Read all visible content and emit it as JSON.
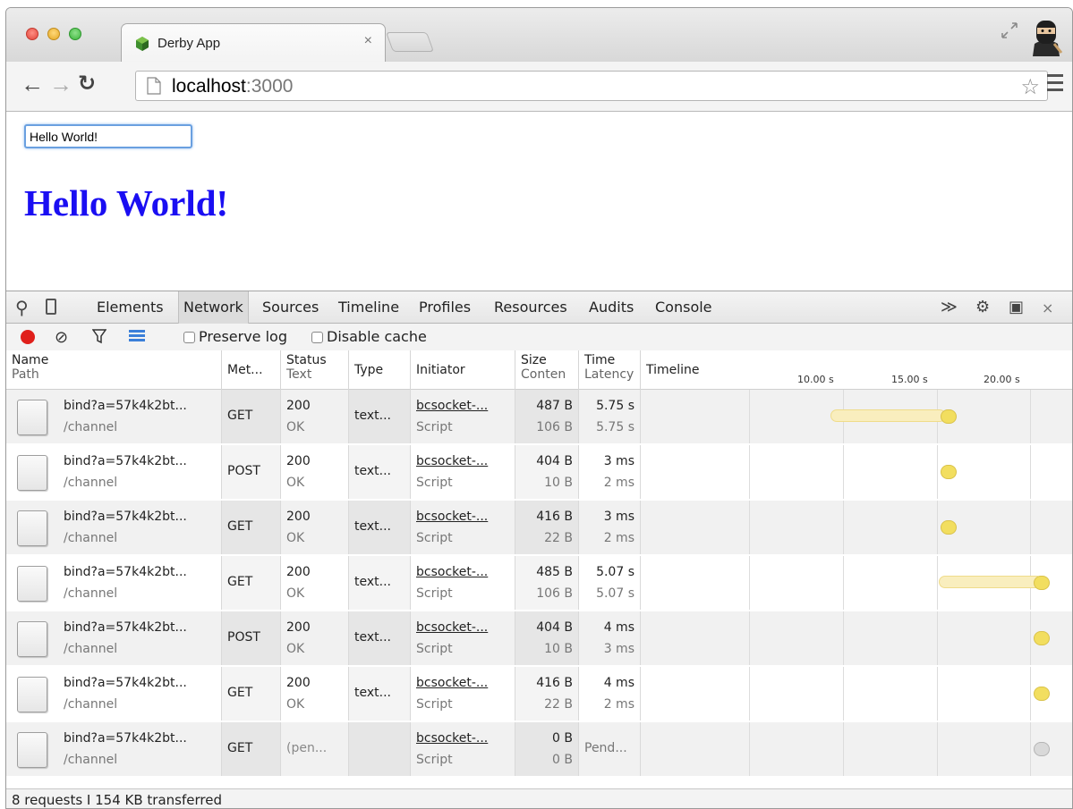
{
  "browser": {
    "tab_title": "Derby App",
    "tab_close": "×",
    "url_host": "localhost",
    "url_port": ":3000"
  },
  "page": {
    "input_value": "Hello World!",
    "heading": "Hello World!"
  },
  "devtools": {
    "tabs": [
      "Elements",
      "Network",
      "Sources",
      "Timeline",
      "Profiles",
      "Resources",
      "Audits",
      "Console"
    ],
    "active_tab": "Network",
    "close": "×",
    "toolbar": {
      "preserve_log": "Preserve log",
      "disable_cache": "Disable cache"
    },
    "columns": {
      "name": "Name",
      "path": "Path",
      "method": "Met...",
      "status": "Status",
      "status_text": "Text",
      "type": "Type",
      "initiator": "Initiator",
      "size": "Size",
      "content": "Conten",
      "time": "Time",
      "latency": "Latency",
      "timeline": "Timeline"
    },
    "ticks": [
      "10.00 s",
      "15.00 s",
      "20.00 s"
    ],
    "rows": [
      {
        "name": "bind?a=57k4k2bt...",
        "path": "/channel",
        "method": "GET",
        "status": "200",
        "status_text": "OK",
        "type": "text...",
        "initiator": "bcsocket-...",
        "initiator_type": "Script",
        "size": "487 B",
        "content": "106 B",
        "time": "5.75 s",
        "latency": "5.75 s"
      },
      {
        "name": "bind?a=57k4k2bt...",
        "path": "/channel",
        "method": "POST",
        "status": "200",
        "status_text": "OK",
        "type": "text...",
        "initiator": "bcsocket-...",
        "initiator_type": "Script",
        "size": "404 B",
        "content": "10 B",
        "time": "3 ms",
        "latency": "2 ms"
      },
      {
        "name": "bind?a=57k4k2bt...",
        "path": "/channel",
        "method": "GET",
        "status": "200",
        "status_text": "OK",
        "type": "text...",
        "initiator": "bcsocket-...",
        "initiator_type": "Script",
        "size": "416 B",
        "content": "22 B",
        "time": "3 ms",
        "latency": "2 ms"
      },
      {
        "name": "bind?a=57k4k2bt...",
        "path": "/channel",
        "method": "GET",
        "status": "200",
        "status_text": "OK",
        "type": "text...",
        "initiator": "bcsocket-...",
        "initiator_type": "Script",
        "size": "485 B",
        "content": "106 B",
        "time": "5.07 s",
        "latency": "5.07 s"
      },
      {
        "name": "bind?a=57k4k2bt...",
        "path": "/channel",
        "method": "POST",
        "status": "200",
        "status_text": "OK",
        "type": "text...",
        "initiator": "bcsocket-...",
        "initiator_type": "Script",
        "size": "404 B",
        "content": "10 B",
        "time": "4 ms",
        "latency": "3 ms"
      },
      {
        "name": "bind?a=57k4k2bt...",
        "path": "/channel",
        "method": "GET",
        "status": "200",
        "status_text": "OK",
        "type": "text...",
        "initiator": "bcsocket-...",
        "initiator_type": "Script",
        "size": "416 B",
        "content": "22 B",
        "time": "4 ms",
        "latency": "2 ms"
      },
      {
        "name": "bind?a=57k4k2bt...",
        "path": "/channel",
        "method": "GET",
        "status": "",
        "status_text": "(pen...",
        "type": "",
        "initiator": "bcsocket-...",
        "initiator_type": "Script",
        "size": "0 B",
        "content": "0 B",
        "time": "Pend...",
        "latency": ""
      }
    ],
    "summary": "8 requests I 154 KB transferred"
  }
}
